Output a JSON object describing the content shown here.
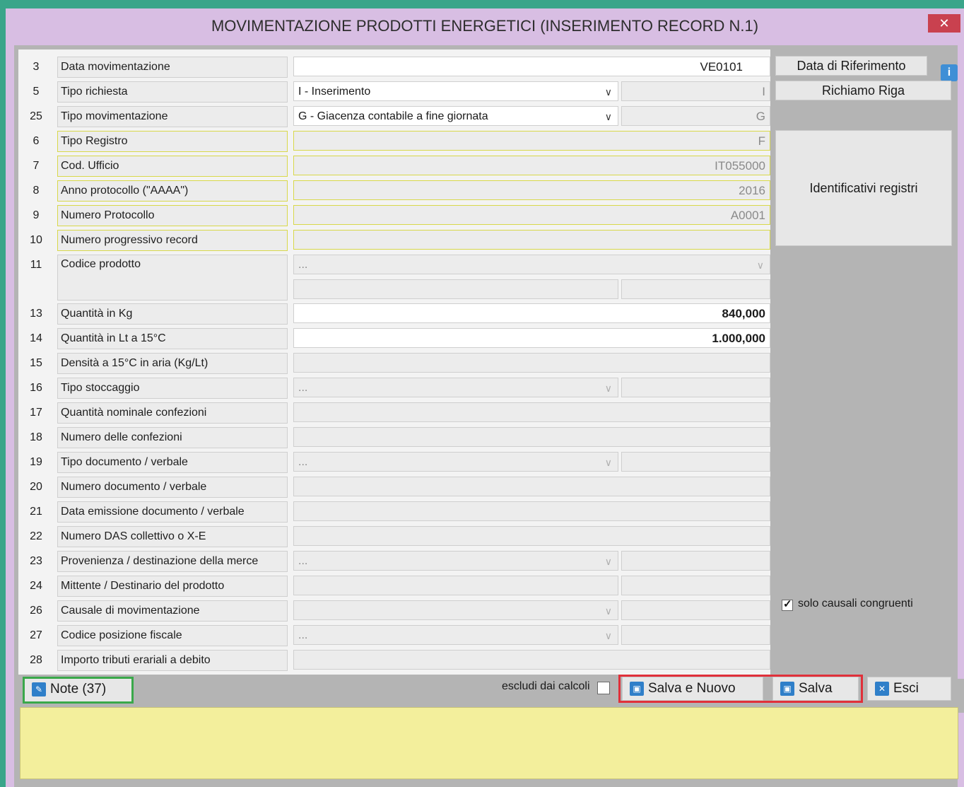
{
  "window": {
    "title": "MOVIMENTAZIONE PRODOTTI ENERGETICI (INSERIMENTO RECORD N.1)",
    "close_glyph": "✕"
  },
  "rows": [
    {
      "num": "3",
      "label": "Data movimentazione",
      "value": "VE0101"
    },
    {
      "num": "5",
      "label": "Tipo richiesta",
      "select": "I - Inserimento",
      "code": "I"
    },
    {
      "num": "25",
      "label": "Tipo movimentazione",
      "select": "G - Giacenza contabile a fine giornata",
      "code": "G"
    },
    {
      "num": "6",
      "label": "Tipo Registro",
      "value": "F"
    },
    {
      "num": "7",
      "label": "Cod. Ufficio",
      "value": "IT055000"
    },
    {
      "num": "8",
      "label": "Anno protocollo (\"AAAA\")",
      "value": "2016"
    },
    {
      "num": "9",
      "label": "Numero Protocollo",
      "value": "A0001"
    },
    {
      "num": "10",
      "label": "Numero progressivo record",
      "value": ""
    },
    {
      "num": "11",
      "label": "Codice prodotto",
      "select": "..."
    },
    {
      "num": "13",
      "label": "Quantità in Kg",
      "value": "840,000"
    },
    {
      "num": "14",
      "label": "Quantità in Lt a 15°C",
      "value": "1.000,000"
    },
    {
      "num": "15",
      "label": "Densità a 15°C in aria (Kg/Lt)",
      "value": ""
    },
    {
      "num": "16",
      "label": "Tipo stoccaggio",
      "select": "..."
    },
    {
      "num": "17",
      "label": "Quantità nominale confezioni",
      "value": ""
    },
    {
      "num": "18",
      "label": "Numero delle confezioni",
      "value": ""
    },
    {
      "num": "19",
      "label": "Tipo documento / verbale",
      "select": "..."
    },
    {
      "num": "20",
      "label": "Numero documento / verbale",
      "value": ""
    },
    {
      "num": "21",
      "label": "Data emissione documento / verbale",
      "value": ""
    },
    {
      "num": "22",
      "label": "Numero DAS collettivo o X-E",
      "value": ""
    },
    {
      "num": "23",
      "label": "Provenienza / destinazione della merce",
      "select": "..."
    },
    {
      "num": "24",
      "label": "Mittente / Destinario del prodotto",
      "value": ""
    },
    {
      "num": "26",
      "label": "Causale di movimentazione",
      "select": ""
    },
    {
      "num": "27",
      "label": "Codice posizione fiscale",
      "select": "..."
    },
    {
      "num": "28",
      "label": "Importo tributi erariali a debito",
      "value": ""
    }
  ],
  "side": {
    "data_riferimento": "Data di Riferimento",
    "richiamo_riga": "Richiamo Riga",
    "identificativi": "Identificativi registri",
    "solo_causali": "solo causali congruenti",
    "solo_causali_checked": true
  },
  "bottom": {
    "note": "Note (37)",
    "escludi": "escludi dai calcoli",
    "escludi_checked": false,
    "salva_nuovo": "Salva e Nuovo",
    "salva": "Salva",
    "esci": "Esci"
  },
  "colors": {
    "title_bg": "#d8bee3",
    "frame": "#3aa58a",
    "note_bg": "#f3ef9c",
    "highlight_yellow": "#d8d84a",
    "highlight_green": "#3aa84a",
    "highlight_red": "#e0303a"
  }
}
